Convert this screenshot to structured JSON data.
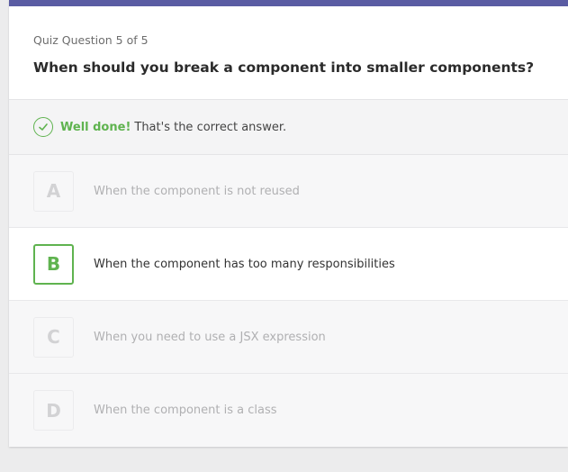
{
  "quiz": {
    "counter": "Quiz Question 5 of 5",
    "question": "When should you break a component into smaller components?"
  },
  "feedback": {
    "icon": "check-circle-icon",
    "headline": "Well done!",
    "message": "That's the correct answer."
  },
  "answers": [
    {
      "letter": "A",
      "text": "When the component is not reused",
      "state": "dimmed"
    },
    {
      "letter": "B",
      "text": "When the component has too many responsibilities",
      "state": "correct"
    },
    {
      "letter": "C",
      "text": "When you need to use a JSX expression",
      "state": "dimmed"
    },
    {
      "letter": "D",
      "text": "When the component is a class",
      "state": "dimmed"
    }
  ],
  "colors": {
    "accent_bar": "#5a5ca3",
    "success": "#5fb34f"
  }
}
